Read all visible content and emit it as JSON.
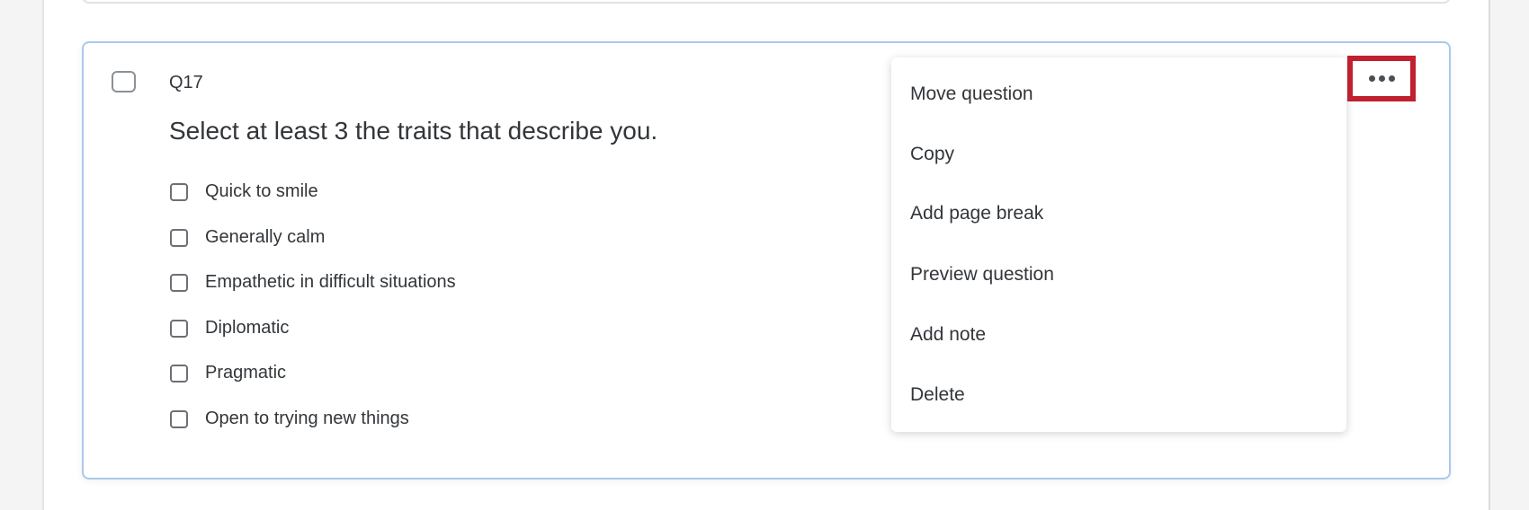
{
  "question": {
    "number": "Q17",
    "text": "Select at least 3 the traits that describe you.",
    "options": [
      "Quick to smile",
      "Generally calm",
      "Empathetic in difficult situations",
      "Diplomatic",
      "Pragmatic",
      "Open to trying new things"
    ]
  },
  "menu": {
    "items": [
      "Move question",
      "Copy",
      "Add page break",
      "Preview question",
      "Add note",
      "Delete"
    ]
  },
  "colors": {
    "highlight": "#c0202f",
    "card_border": "#a9c9ec"
  },
  "icons": {
    "more": "ellipsis-icon"
  }
}
